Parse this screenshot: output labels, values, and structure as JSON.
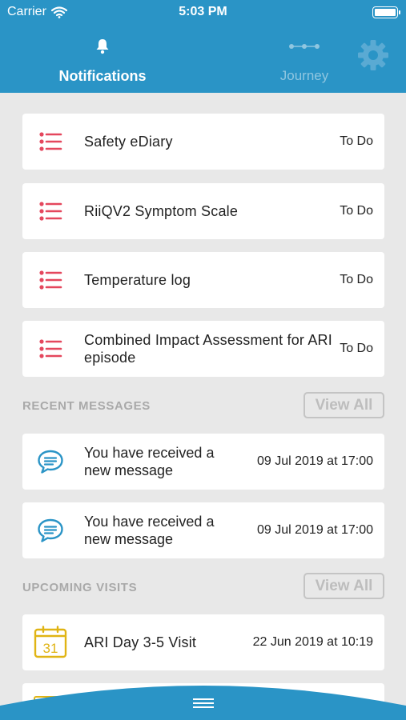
{
  "status_bar": {
    "carrier": "Carrier",
    "time": "5:03 PM"
  },
  "tabs": [
    {
      "label": "Notifications",
      "icon": "bell-icon",
      "active": true
    },
    {
      "label": "Journey",
      "icon": "journey-icon",
      "active": false
    }
  ],
  "tasks": [
    {
      "title": "Safety eDiary",
      "status": "To Do"
    },
    {
      "title": "RiiQV2 Symptom Scale",
      "status": "To Do"
    },
    {
      "title": "Temperature log",
      "status": "To Do"
    },
    {
      "title": "Combined Impact Assessment for ARI episode",
      "status": "To Do"
    }
  ],
  "recent_messages": {
    "title": "RECENT MESSAGES",
    "view_all": "View All",
    "items": [
      {
        "title": "You have received a new message",
        "date": "09 Jul 2019 at 17:00"
      },
      {
        "title": "You have received a new message",
        "date": "09 Jul 2019 at 17:00"
      }
    ]
  },
  "upcoming_visits": {
    "title": "UPCOMING VISITS",
    "view_all": "View All",
    "items": [
      {
        "title": "ARI Day 3-5 Visit",
        "date": "22 Jun 2019 at 10:19",
        "calendar_day": "31"
      }
    ]
  },
  "colors": {
    "header": "#2a94c6",
    "task_icon": "#e4475d",
    "message_icon": "#2a94c6",
    "calendar_icon": "#e0b414",
    "background": "#e8e8e8"
  }
}
